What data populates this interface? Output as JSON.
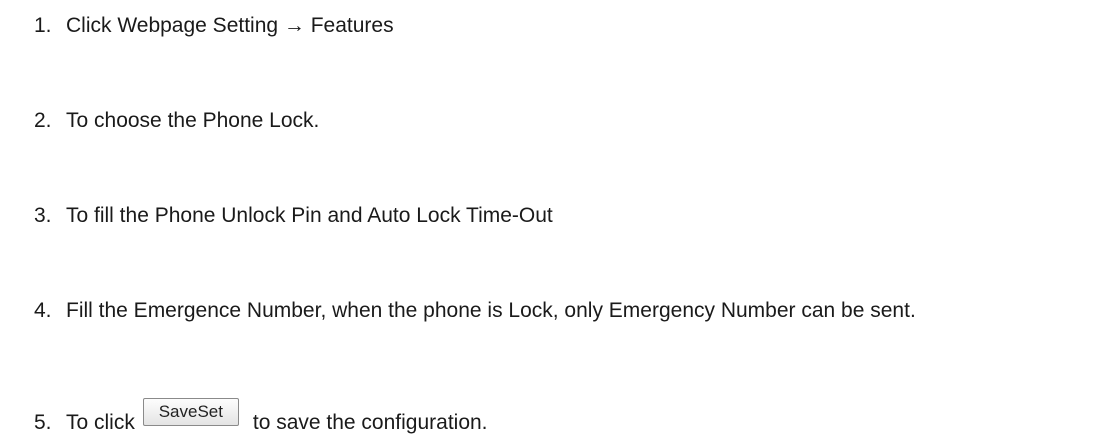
{
  "steps": [
    {
      "num": "1.",
      "text": "Click Webpage Setting → Features"
    },
    {
      "num": "2.",
      "text": "To choose the Phone Lock."
    },
    {
      "num": "3.",
      "text": "To fill the Phone Unlock Pin and Auto Lock Time-Out"
    },
    {
      "num": "4.",
      "text": "Fill the Emergence Number, when the phone is Lock, only Emergency Number can be sent."
    },
    {
      "num": "5.",
      "text_before": "To click",
      "button_label": "SaveSet",
      "text_after": "to save the configuration."
    }
  ]
}
